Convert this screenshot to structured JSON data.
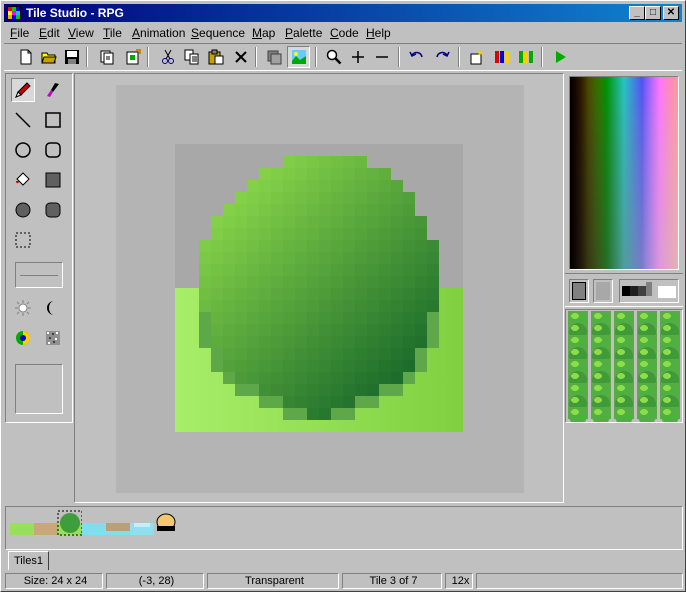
{
  "window": {
    "title": "Tile Studio - RPG"
  },
  "titlebar_buttons": {
    "minimize": "_",
    "maximize": "□",
    "close": "✕"
  },
  "menu": [
    {
      "label": "File",
      "key": "F"
    },
    {
      "label": "Edit",
      "key": "E"
    },
    {
      "label": "View",
      "key": "V"
    },
    {
      "label": "Tile",
      "key": "T"
    },
    {
      "label": "Animation",
      "key": "A"
    },
    {
      "label": "Sequence",
      "key": "S"
    },
    {
      "label": "Map",
      "key": "M"
    },
    {
      "label": "Palette",
      "key": "P"
    },
    {
      "label": "Code",
      "key": "C"
    },
    {
      "label": "Help",
      "key": "H"
    }
  ],
  "toolbar": [
    "new-icon",
    "open-icon",
    "save-icon",
    "new-tile-set-icon",
    "import-tiles-icon",
    "cut-icon",
    "copy-icon",
    "paste-icon",
    "delete-icon",
    "layer-back-icon",
    "layer-front-icon",
    "zoom-icon",
    "zoom-in-icon",
    "zoom-out-icon",
    "undo-icon",
    "redo-icon",
    "lighting-icon",
    "color-bars-icon",
    "palette-bars-icon",
    "run-icon"
  ],
  "tools": [
    "pencil-icon",
    "brush-icon",
    "line-icon",
    "rectangle-icon",
    "ellipse-icon",
    "rounded-rect-icon",
    "fill-icon",
    "filled-rect-icon",
    "filled-ellipse-icon",
    "filled-rounded-rect-icon",
    "selection-icon",
    "lighten-icon",
    "darken-icon",
    "color-adjust-icon",
    "noise-icon"
  ],
  "colors": {
    "fg": "#808080",
    "bg": "#a0a0a0",
    "tile_bg": "#a8a8a8",
    "grass": "#9ee85f",
    "bush_dark": "#0d5d28",
    "bush_light": "#8fdc4b"
  },
  "tile_strip": [
    {
      "name": "grass",
      "color": "#99e05a"
    },
    {
      "name": "sand",
      "color": "#c8a878"
    },
    {
      "name": "bush",
      "color": "#3e9d3c"
    },
    {
      "name": "water",
      "color": "#7ee0ee"
    },
    {
      "name": "sand-water",
      "color": "#b8a078"
    },
    {
      "name": "water-2",
      "color": "#8ee0ee"
    },
    {
      "name": "rock",
      "color": "#f0c870"
    }
  ],
  "tabs": [
    {
      "label": "Tiles1"
    }
  ],
  "status": {
    "size": "Size: 24 x 24",
    "coords": "(-3, 28)",
    "color": "Transparent",
    "tile": "Tile 3 of 7",
    "zoom": "12x"
  }
}
